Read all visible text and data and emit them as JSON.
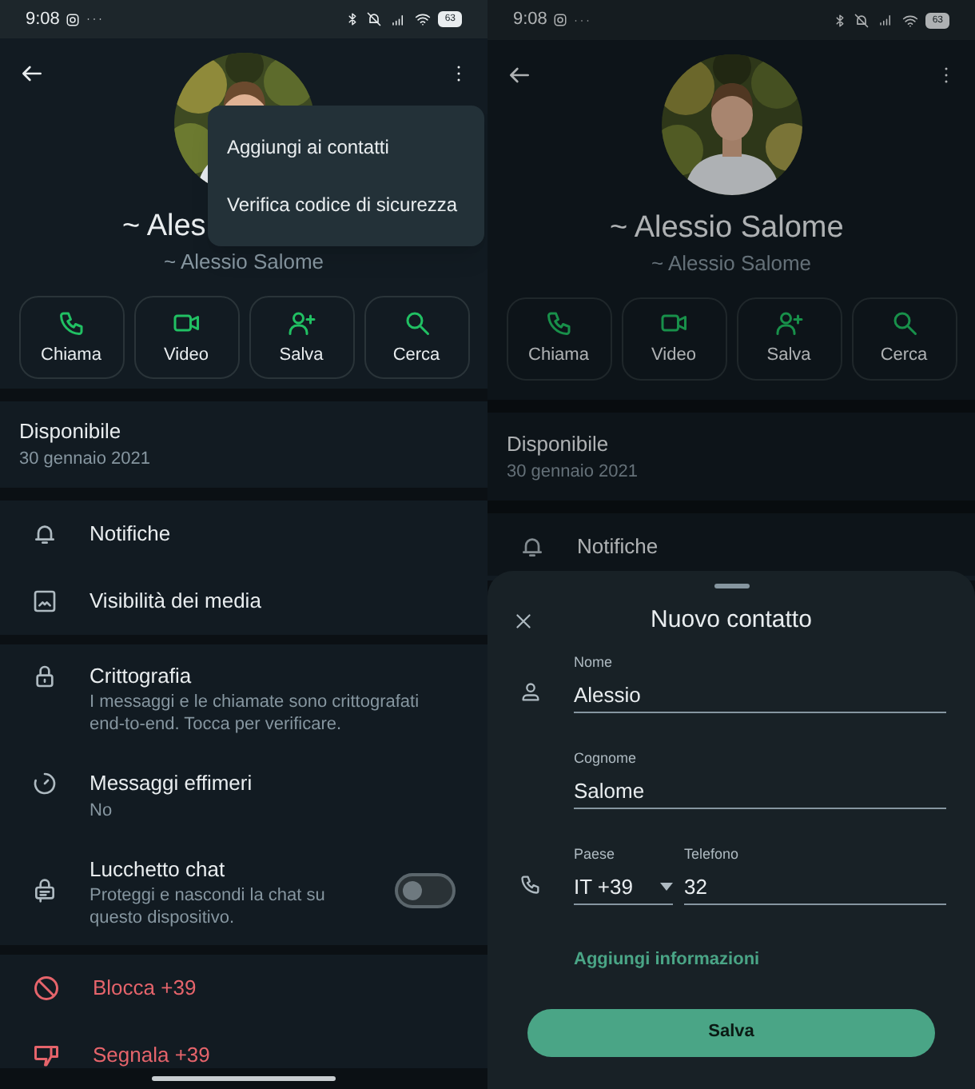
{
  "screens": [
    {
      "status_bar": {
        "time": "9:08",
        "battery": "63"
      },
      "profile": {
        "name": "~ Ales",
        "subtitle": "~ Alessio Salome"
      },
      "actions": [
        {
          "label": "Chiama"
        },
        {
          "label": "Video"
        },
        {
          "label": "Salva"
        },
        {
          "label": "Cerca"
        }
      ],
      "about": {
        "status": "Disponibile",
        "date": "30 gennaio 2021"
      },
      "groups": [
        [
          {
            "kind": "setting",
            "title": "Notifiche"
          },
          {
            "kind": "setting",
            "title": "Visibilità dei media"
          }
        ],
        [
          {
            "kind": "setting",
            "title": "Crittografia",
            "subtitle": "I messaggi e le chiamate sono crittografati end-to-end. Tocca per verificare."
          },
          {
            "kind": "setting",
            "title": "Messaggi effimeri",
            "subtitle": "No"
          },
          {
            "kind": "toggle",
            "title": "Lucchetto chat",
            "subtitle": "Proteggi e nascondi la chat su questo dispositivo.",
            "on": false
          }
        ],
        [
          {
            "kind": "danger",
            "title": "Blocca +39"
          },
          {
            "kind": "danger",
            "title": "Segnala +39"
          }
        ]
      ],
      "menu": [
        "Aggiungi ai contatti",
        "Verifica codice di sicurezza"
      ]
    },
    {
      "status_bar": {
        "time": "9:08",
        "battery": "63"
      },
      "profile": {
        "name": "~ Alessio Salome",
        "subtitle": "~ Alessio Salome"
      },
      "actions": [
        {
          "label": "Chiama"
        },
        {
          "label": "Video"
        },
        {
          "label": "Salva"
        },
        {
          "label": "Cerca"
        }
      ],
      "about": {
        "status": "Disponibile",
        "date": "30 gennaio 2021"
      },
      "groups": [
        [
          {
            "kind": "setting",
            "title": "Notifiche"
          }
        ]
      ],
      "sheet": {
        "title": "Nuovo contatto",
        "first_name": {
          "label": "Nome",
          "value": "Alessio"
        },
        "last_name": {
          "label": "Cognome",
          "value": "Salome"
        },
        "country": {
          "label": "Paese",
          "value": "IT +39"
        },
        "phone": {
          "label": "Telefono",
          "value": "32"
        },
        "more_link": "Aggiungi informazioni",
        "save": "Salva"
      }
    }
  ]
}
